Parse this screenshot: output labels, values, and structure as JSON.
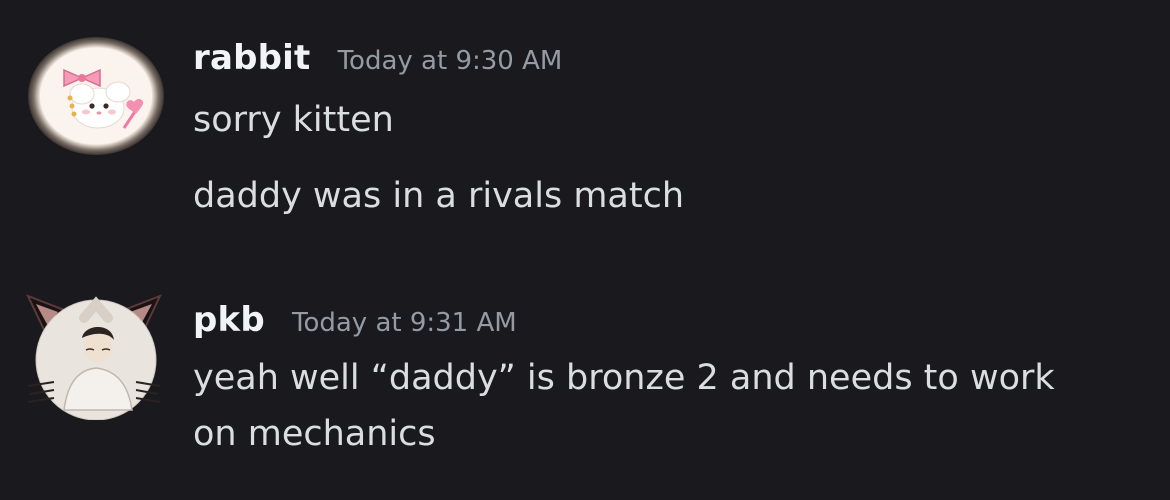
{
  "messages": [
    {
      "username": "rabbit",
      "timestamp": "Today at 9:30 AM",
      "lines": [
        "sorry kitten",
        "daddy was in a rivals match"
      ]
    },
    {
      "username": "pkb",
      "timestamp": "Today at 9:31 AM",
      "lines": [
        "yeah well “daddy” is bronze 2 and needs to work",
        "on mechanics"
      ]
    }
  ],
  "colors": {
    "background": "#1a1a1e",
    "username": "#f2f3f5",
    "timestamp": "#949ba4",
    "message_text": "#dbdee1"
  }
}
